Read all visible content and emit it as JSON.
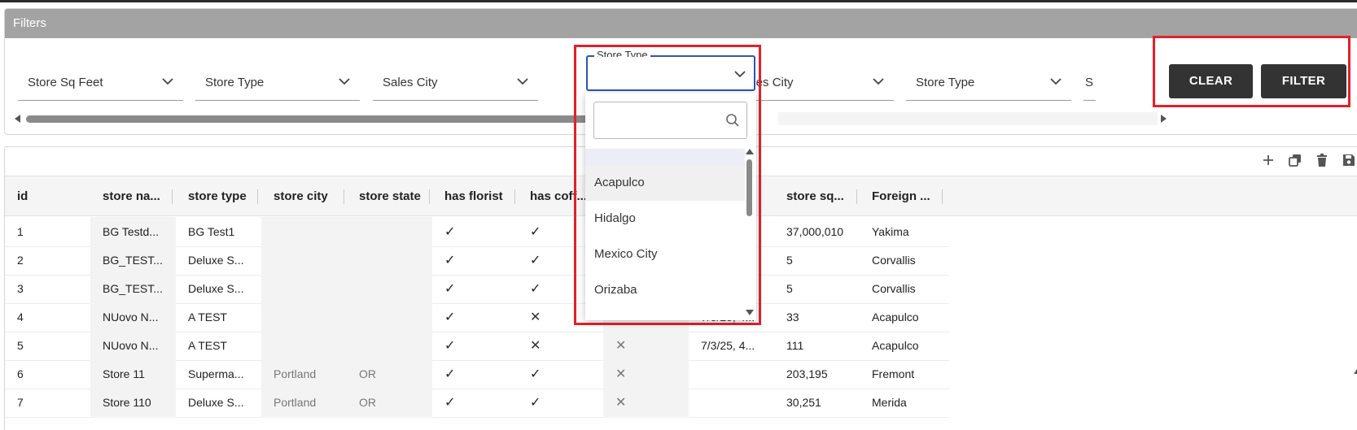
{
  "filters": {
    "header": "Filters",
    "selects": [
      {
        "label": "Store Sq Feet"
      },
      {
        "label": "Store Type"
      },
      {
        "label": "Sales City"
      },
      {
        "label": "Sales City"
      },
      {
        "label": "Store Type"
      },
      {
        "label": "S"
      }
    ],
    "active_select": {
      "legend": "Store Type",
      "value": ""
    },
    "dropdown": {
      "search_placeholder": "",
      "options": [
        "Acapulco",
        "Hidalgo",
        "Mexico City",
        "Orizaba"
      ],
      "hovered": "Acapulco"
    },
    "clear_label": "CLEAR",
    "filter_label": "FILTER"
  },
  "toolbar": {
    "icons": [
      "add-icon",
      "duplicate-icon",
      "delete-icon",
      "save-icon"
    ]
  },
  "grid": {
    "columns": [
      "id",
      "store na...",
      "store type",
      "store city",
      "store state",
      "has florist",
      "has coff...",
      "",
      "",
      "store sq...",
      "Foreign ..."
    ],
    "rows": [
      {
        "id": "1",
        "name": "BG Testd...",
        "type": "BG Test1",
        "city": "",
        "state": "",
        "florist": "check",
        "coffee": "check",
        "c7": "",
        "c8": "",
        "sqft": "37,000,010",
        "foreign": "Yakima"
      },
      {
        "id": "2",
        "name": "BG_TEST...",
        "type": "Deluxe S...",
        "city": "",
        "state": "",
        "florist": "check",
        "coffee": "check",
        "c7": "",
        "c8": "",
        "sqft": "5",
        "foreign": "Corvallis"
      },
      {
        "id": "3",
        "name": "BG_TEST...",
        "type": "Deluxe S...",
        "city": "",
        "state": "",
        "florist": "check",
        "coffee": "check",
        "c7": "",
        "c8": "",
        "sqft": "5",
        "foreign": "Corvallis"
      },
      {
        "id": "4",
        "name": "NUovo N...",
        "type": "A TEST",
        "city": "",
        "state": "",
        "florist": "check",
        "coffee": "cross",
        "c7": "cross-light",
        "c8": "7/3/25, 4...",
        "sqft": "33",
        "foreign": "Acapulco"
      },
      {
        "id": "5",
        "name": "NUovo N...",
        "type": "A TEST",
        "city": "",
        "state": "",
        "florist": "check",
        "coffee": "cross",
        "c7": "cross-light",
        "c8": "7/3/25, 4...",
        "sqft": "111",
        "foreign": "Acapulco"
      },
      {
        "id": "6",
        "name": "Store 11",
        "type": "Superma...",
        "city": "Portland",
        "state": "OR",
        "florist": "check",
        "coffee": "check",
        "c7": "cross-light",
        "c8": "",
        "sqft": "203,195",
        "foreign": "Fremont"
      },
      {
        "id": "7",
        "name": "Store 110",
        "type": "Deluxe S...",
        "city": "Portland",
        "state": "OR",
        "florist": "check",
        "coffee": "check",
        "c7": "cross-light",
        "c8": "",
        "sqft": "30,251",
        "foreign": "Merida"
      }
    ]
  },
  "colors": {
    "highlight": "#e4202b",
    "button": "#333333",
    "focus": "#2b57b0"
  }
}
